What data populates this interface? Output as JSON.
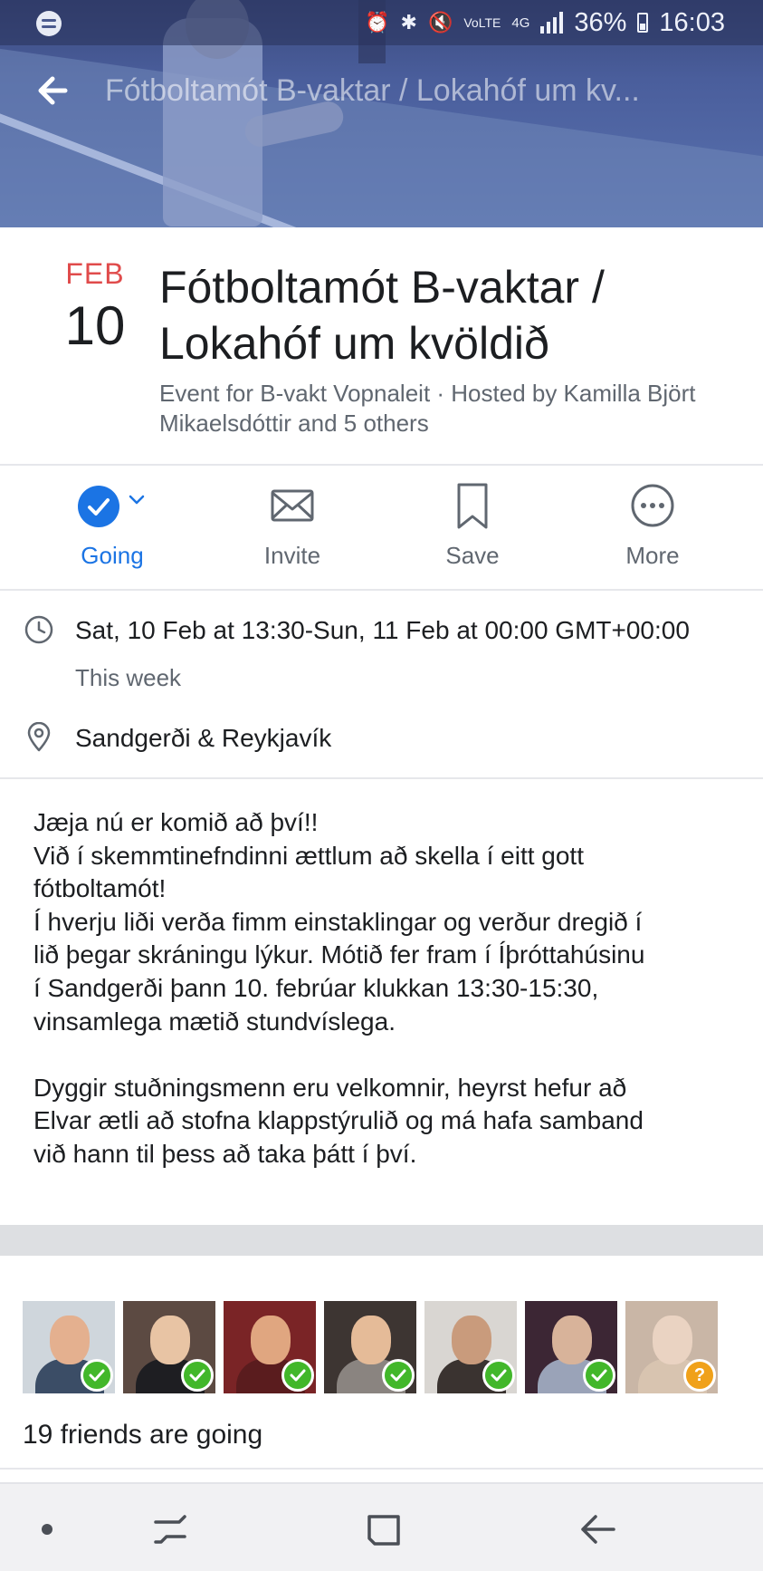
{
  "status_bar": {
    "battery": "36%",
    "time": "16:03",
    "network": "4G",
    "volte": "VoLTE"
  },
  "header": {
    "title": "Fótboltamót B-vaktar / Lokahóf um kv..."
  },
  "event": {
    "month": "FEB",
    "day": "10",
    "title_line1": "Fótboltamót B-vaktar /",
    "title_line2": "Lokahóf um kvöldið",
    "subtitle_line1": "Event for B-vakt Vopnaleit · Hosted by Kamilla Björt",
    "subtitle_line2": "Mikaelsdóttir and 5 others"
  },
  "actions": [
    {
      "label": "Going",
      "icon": "check-circle-icon",
      "active": true
    },
    {
      "label": "Invite",
      "icon": "envelope-icon"
    },
    {
      "label": "Save",
      "icon": "bookmark-icon"
    },
    {
      "label": "More",
      "icon": "more-icon"
    }
  ],
  "details": {
    "datetime": "Sat, 10 Feb at 13:30-Sun, 11 Feb at 00:00 GMT+00:00",
    "relative": "This week",
    "location": "Sandgerði & Reykjavík"
  },
  "description": {
    "lines_p1": [
      "Jæja nú er komið að því!!",
      "Við í skemmtinefndinni ættlum að skella í eitt gott",
      "fótboltamót!",
      "Í hverju liði verða fimm einstaklingar og verður dregið í",
      "lið þegar skráningu lýkur. Mótið fer fram í Íþróttahúsinu",
      "í Sandgerði þann 10. febrúar klukkan 13:30-15:30,",
      "vinsamlega mætið stundvíslega."
    ],
    "lines_p2": [
      "Dyggir stuðningsmenn eru velkomnir, heyrst hefur að",
      "Elvar ætli að stofna klappstýrulið og má hafa samband",
      "við hann til þess að taka þátt í því."
    ]
  },
  "friends": {
    "count_text": "19 friends are going",
    "avatars": [
      {
        "status": "going",
        "bg": "#cfd6dc",
        "face": "#e4b08f",
        "body": "#3b4d66"
      },
      {
        "status": "going",
        "bg": "#5c4a42",
        "face": "#e8c4a4",
        "body": "#1e1e22"
      },
      {
        "status": "going",
        "bg": "#7a2426",
        "face": "#e0a680",
        "body": "#5a1c1e"
      },
      {
        "status": "going",
        "bg": "#3d3532",
        "face": "#e5bb98",
        "body": "#8a8480"
      },
      {
        "status": "going",
        "bg": "#d9d6d2",
        "face": "#c99b7c",
        "body": "#3a3330"
      },
      {
        "status": "going",
        "bg": "#3c2634",
        "face": "#d8b39a",
        "body": "#9aa3b8"
      },
      {
        "status": "maybe",
        "bg": "#c9b6a6",
        "face": "#ead3c2",
        "body": "#d8c4b0"
      }
    ],
    "badge_colors": {
      "going": "#42b72a",
      "maybe": "#f0a11a"
    }
  },
  "colors": {
    "accent": "#1b74e4",
    "date_month": "#e04b4b",
    "secondary_text": "#606770"
  }
}
